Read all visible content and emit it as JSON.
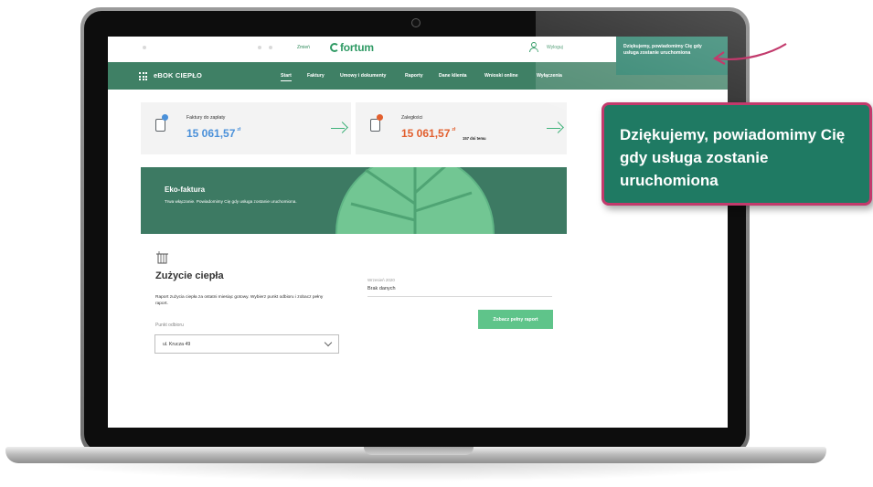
{
  "header": {
    "zmien": "Zmień",
    "logo": "fortum",
    "logout": "Wyloguj"
  },
  "nav": {
    "brand": "eBOK CIEPŁO",
    "items": [
      {
        "label": "Start",
        "active": true
      },
      {
        "label": "Faktury"
      },
      {
        "label": "Umowy i dokumenty"
      },
      {
        "label": "Raporty"
      },
      {
        "label": "Dane klienta"
      },
      {
        "label": "Wnioski online"
      },
      {
        "label": "Wyłączenia"
      }
    ]
  },
  "notice": {
    "text": "Dziękujemy, powiadomimy Cię gdy usługa zostanie uruchomiona"
  },
  "cards": [
    {
      "label": "Faktury do zapłaty",
      "amount": "15 061,57",
      "currency": "zł",
      "amount_color": "#4a90d9",
      "badge_color": "#4a90d9"
    },
    {
      "label": "Zaległości",
      "amount": "15 061,57",
      "currency": "zł",
      "days": "157 dni temu",
      "amount_color": "#e25f2e",
      "badge_color": "#e25f2e"
    }
  ],
  "banner": {
    "title": "Eko-faktura",
    "text": "Trwa włączanie. Powiadomimy Cię gdy usługa zostanie uruchomiona."
  },
  "consumption": {
    "title": "Zużycie ciepła",
    "description": "Raport zużycia ciepła za ostatni miesiąc gotowy. Wybierz punkt odbioru i zobacz pełny raport.",
    "point_label": "Punkt odbioru",
    "point_value": "ul. Krucza 49",
    "period_label": "Wrzesień 2020",
    "period_value": "Brak danych",
    "button": "Zobacz pełny raport"
  },
  "callout": {
    "text": "Dziękujemy, powiadomimy Cię gdy usługa zostanie uruchomiona"
  },
  "colors": {
    "nav_bg": "#3f8065",
    "notice_bg": "#1f7a63",
    "accent_green": "#5fc48a",
    "callout_border": "#c23a6c"
  }
}
